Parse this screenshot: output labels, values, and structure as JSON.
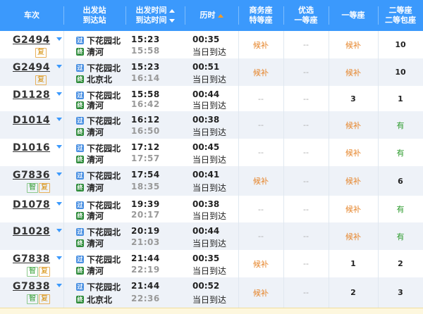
{
  "header": {
    "train": "车次",
    "station_from": "出发站",
    "station_to": "到达站",
    "time_dep": "出发时间",
    "time_arr": "到达时间",
    "duration": "历时",
    "business_l1": "商务座",
    "business_l2": "特等座",
    "premium_l1": "优选",
    "premium_l2": "一等座",
    "first": "一等座",
    "second_l1": "二等座",
    "second_l2": "二等包座"
  },
  "trains": [
    {
      "no": "G2494",
      "badges": [
        "复"
      ],
      "from": "下花园北",
      "from_icon": "过",
      "to": "清河",
      "to_icon": "终",
      "dep": "15:23",
      "arr": "15:58",
      "dur": "00:35",
      "arrday": "当日到达",
      "business": "候补",
      "premium": "--",
      "first": "候补",
      "second": "10"
    },
    {
      "no": "G2494",
      "badges": [
        "复"
      ],
      "from": "下花园北",
      "from_icon": "过",
      "to": "北京北",
      "to_icon": "终",
      "dep": "15:23",
      "arr": "16:14",
      "dur": "00:51",
      "arrday": "当日到达",
      "business": "候补",
      "premium": "--",
      "first": "候补",
      "second": "10"
    },
    {
      "no": "D1128",
      "badges": [],
      "from": "下花园北",
      "from_icon": "过",
      "to": "清河",
      "to_icon": "终",
      "dep": "15:58",
      "arr": "16:42",
      "dur": "00:44",
      "arrday": "当日到达",
      "business": "--",
      "premium": "--",
      "first": "3",
      "second": "1"
    },
    {
      "no": "D1014",
      "badges": [],
      "from": "下花园北",
      "from_icon": "过",
      "to": "清河",
      "to_icon": "终",
      "dep": "16:12",
      "arr": "16:50",
      "dur": "00:38",
      "arrday": "当日到达",
      "business": "--",
      "premium": "--",
      "first": "候补",
      "second": "有"
    },
    {
      "no": "D1016",
      "badges": [],
      "from": "下花园北",
      "from_icon": "过",
      "to": "清河",
      "to_icon": "终",
      "dep": "17:12",
      "arr": "17:57",
      "dur": "00:45",
      "arrday": "当日到达",
      "business": "--",
      "premium": "--",
      "first": "候补",
      "second": "有"
    },
    {
      "no": "G7836",
      "badges": [
        "智",
        "复"
      ],
      "from": "下花园北",
      "from_icon": "过",
      "to": "清河",
      "to_icon": "终",
      "dep": "17:54",
      "arr": "18:35",
      "dur": "00:41",
      "arrday": "当日到达",
      "business": "候补",
      "premium": "--",
      "first": "候补",
      "second": "6"
    },
    {
      "no": "D1078",
      "badges": [],
      "from": "下花园北",
      "from_icon": "过",
      "to": "清河",
      "to_icon": "终",
      "dep": "19:39",
      "arr": "20:17",
      "dur": "00:38",
      "arrday": "当日到达",
      "business": "--",
      "premium": "--",
      "first": "候补",
      "second": "有"
    },
    {
      "no": "D1028",
      "badges": [],
      "from": "下花园北",
      "from_icon": "过",
      "to": "清河",
      "to_icon": "终",
      "dep": "20:19",
      "arr": "21:03",
      "dur": "00:44",
      "arrday": "当日到达",
      "business": "--",
      "premium": "--",
      "first": "候补",
      "second": "有"
    },
    {
      "no": "G7838",
      "badges": [
        "智",
        "复"
      ],
      "from": "下花园北",
      "from_icon": "过",
      "to": "清河",
      "to_icon": "终",
      "dep": "21:44",
      "arr": "22:19",
      "dur": "00:35",
      "arrday": "当日到达",
      "business": "候补",
      "premium": "--",
      "first": "1",
      "second": "2"
    },
    {
      "no": "G7838",
      "badges": [
        "智",
        "复"
      ],
      "from": "下花园北",
      "from_icon": "过",
      "to": "北京北",
      "to_icon": "终",
      "dep": "21:44",
      "arr": "22:36",
      "dur": "00:52",
      "arrday": "当日到达",
      "business": "候补",
      "premium": "--",
      "first": "2",
      "second": "3"
    }
  ],
  "colors": {
    "header": "#3B99FC",
    "hou": "#e6852b",
    "you": "#2d9b2d",
    "row_alt": "#eef2f8"
  }
}
